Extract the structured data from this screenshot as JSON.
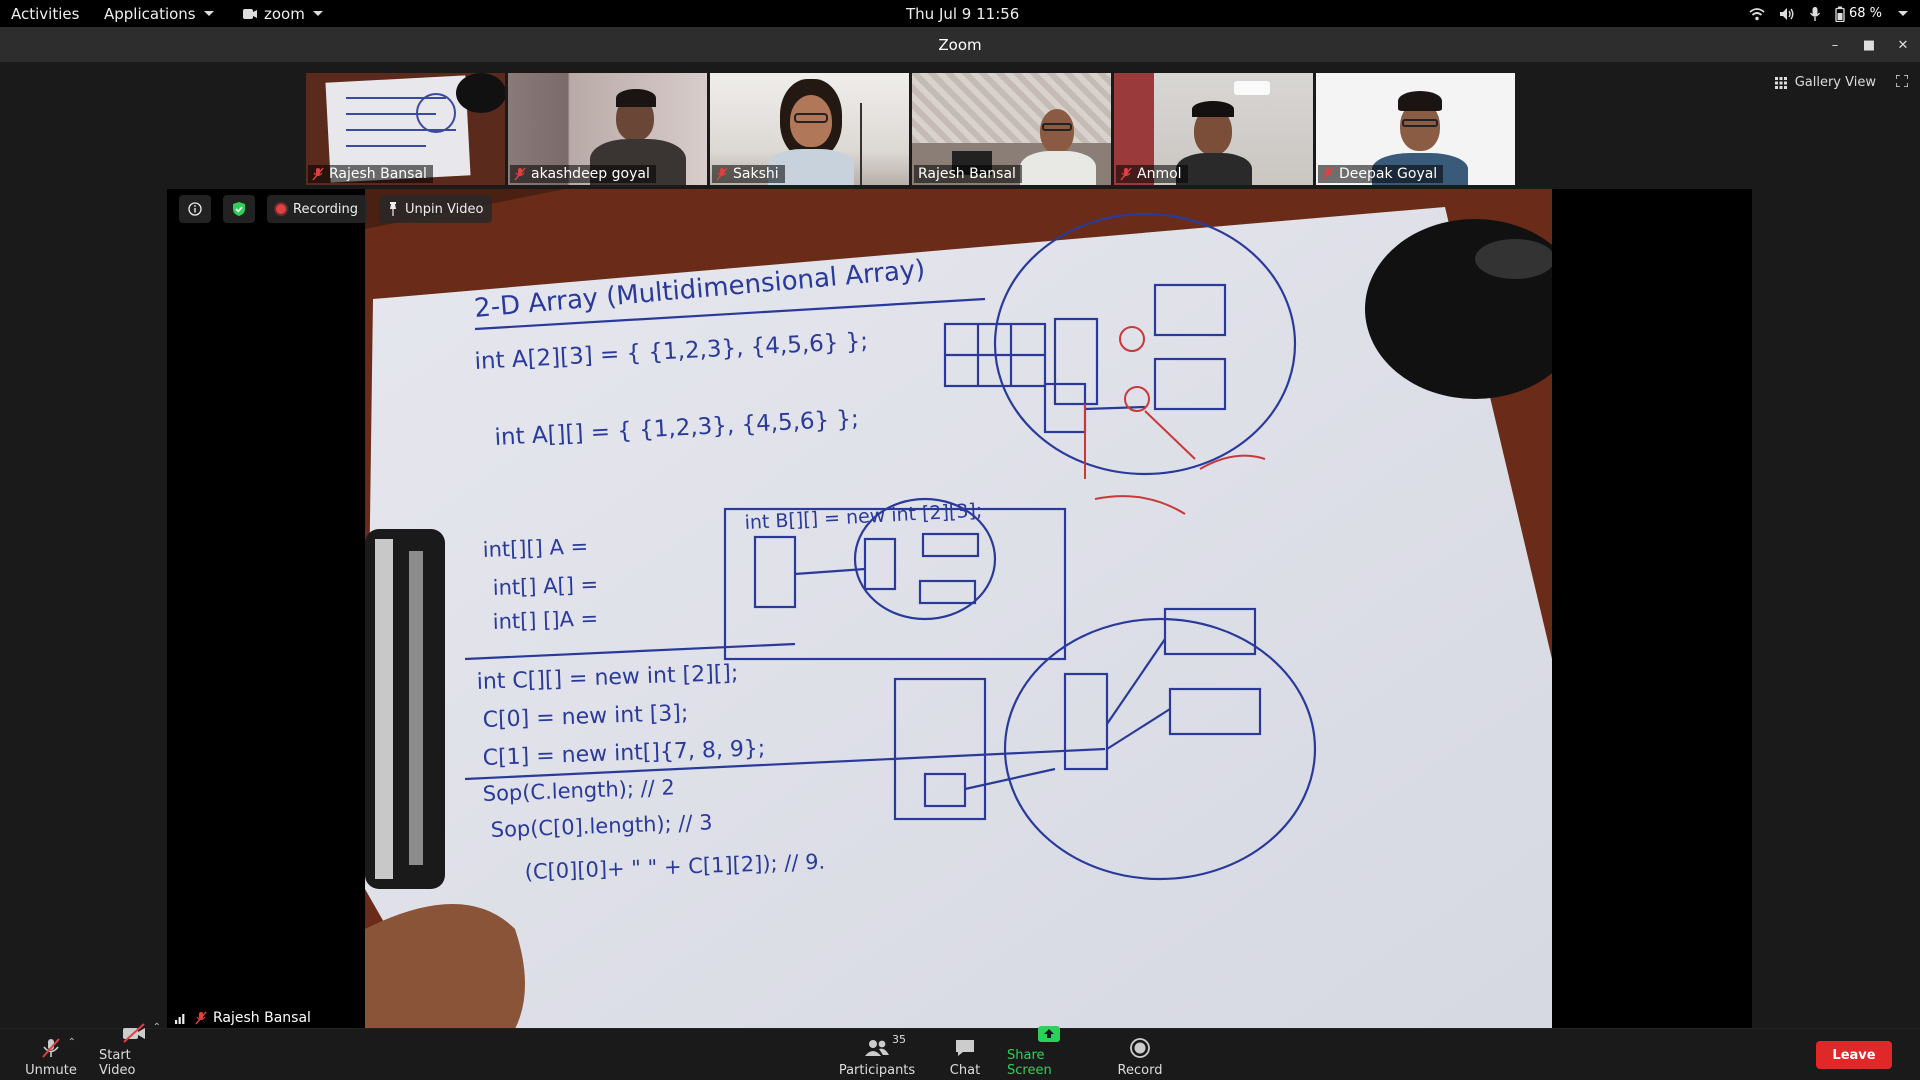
{
  "system_bar": {
    "activities": "Activities",
    "applications": "Applications",
    "app_menu": "zoom",
    "clock": "Thu Jul 9  11:56",
    "battery": "68 %"
  },
  "window": {
    "title": "Zoom"
  },
  "gallery": {
    "view_label": "Gallery View",
    "participants": [
      {
        "name": "Rajesh Bansal"
      },
      {
        "name": "akashdeep goyal"
      },
      {
        "name": "Sakshi"
      },
      {
        "name": "Rajesh Bansal"
      },
      {
        "name": "Anmol"
      },
      {
        "name": "Deepak Goyal"
      }
    ]
  },
  "stage": {
    "recording_label": "Recording",
    "unpin_label": "Unpin Video",
    "active_speaker": "Rajesh Bansal",
    "whiteboard": {
      "title": "2-D Array (Multidimensional Array)",
      "lines": [
        "int A[2][3] = { {1,2,3}, {4,5,6} };",
        "int A[][] = { {1,2,3}, {4,5,6} };",
        "int[][] A =",
        "int[] A[] =",
        "int[] []A =",
        "int B[][] = new int [2][3];",
        "int C[][] = new int [2][];",
        "C[0] = new int [3];",
        "C[1] = new int[]{7, 8, 9};",
        "Sop(C.length); // 2",
        "Sop(C[0].length); // 3",
        "(C[0][0]+ \"  \" + C[1][2]); // 9."
      ]
    }
  },
  "toolbar": {
    "unmute": "Unmute",
    "start_video": "Start Video",
    "participants": "Participants",
    "participants_count": "35",
    "chat": "Chat",
    "share_screen": "Share Screen",
    "record": "Record",
    "leave": "Leave"
  },
  "colors": {
    "share_green": "#2fd05a",
    "leave_red": "#e02828",
    "active_tile_border": "#8fd13b"
  }
}
